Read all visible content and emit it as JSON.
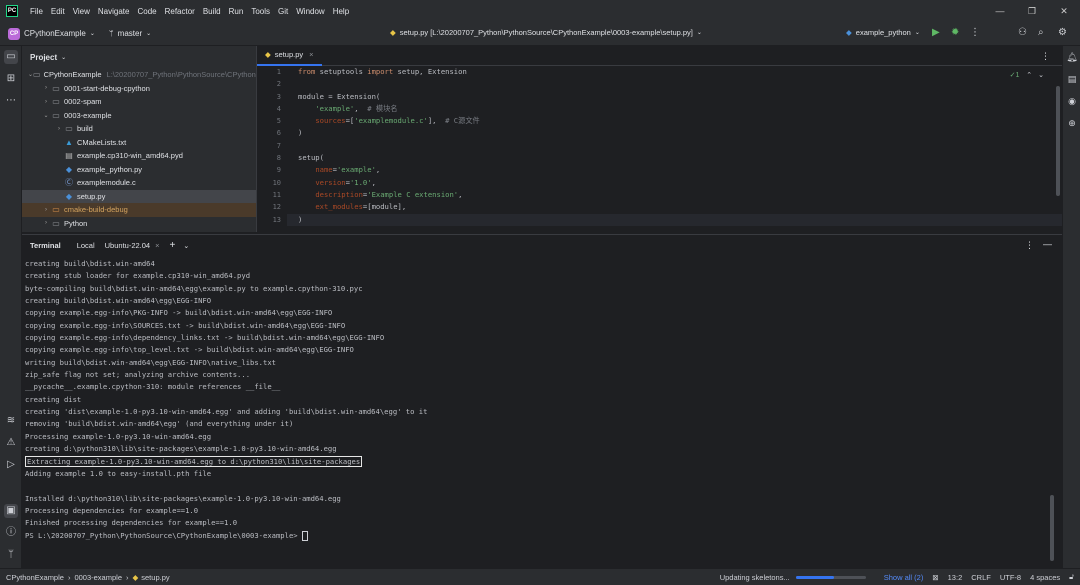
{
  "menu": [
    "File",
    "Edit",
    "View",
    "Navigate",
    "Code",
    "Refactor",
    "Build",
    "Run",
    "Tools",
    "Git",
    "Window",
    "Help"
  ],
  "toolbar": {
    "project_badge": "CP",
    "project_name": "CPythonExample",
    "branch": "master",
    "file_path": "setup.py [L:\\20200707_Python\\PythonSource\\CPythonExample\\0003-example\\setup.py]",
    "run_config": "example_python"
  },
  "project": {
    "title": "Project",
    "items": [
      {
        "label": "CPythonExample",
        "extra": "L:\\20200707_Python\\PythonSource\\CPythonExam",
        "depth": 0,
        "arrow": "v",
        "icon": "folder-icon"
      },
      {
        "label": "0001-start-debug-cpython",
        "depth": 1,
        "arrow": ">",
        "icon": "folder-icon"
      },
      {
        "label": "0002-spam",
        "depth": 1,
        "arrow": ">",
        "icon": "folder-icon"
      },
      {
        "label": "0003-example",
        "depth": 1,
        "arrow": "v",
        "icon": "folder-icon"
      },
      {
        "label": "build",
        "depth": 2,
        "arrow": ">",
        "icon": "folder-icon"
      },
      {
        "label": "CMakeLists.txt",
        "depth": 2,
        "arrow": "",
        "icon": "cmake-icon"
      },
      {
        "label": "example.cp310-win_amd64.pyd",
        "depth": 2,
        "arrow": "",
        "icon": "file-icon"
      },
      {
        "label": "example_python.py",
        "depth": 2,
        "arrow": "",
        "icon": "python-icon"
      },
      {
        "label": "examplemodule.c",
        "depth": 2,
        "arrow": "",
        "icon": "c-file-icon"
      },
      {
        "label": "setup.py",
        "depth": 2,
        "arrow": "",
        "icon": "python-icon"
      },
      {
        "label": "cmake-build-debug",
        "depth": 1,
        "arrow": ">",
        "icon": "folder-icon"
      },
      {
        "label": "Python",
        "depth": 1,
        "arrow": ">",
        "icon": "folder-icon"
      }
    ]
  },
  "editor": {
    "tab": "setup.py",
    "line_numbers": [
      "1",
      "2",
      "3",
      "4",
      "5",
      "6",
      "7",
      "8",
      "9",
      "10",
      "11",
      "12",
      "13"
    ],
    "inspection_count": "1",
    "lines": [
      [
        {
          "t": "from",
          "c": "kw"
        },
        {
          "t": " setuptools ",
          "c": ""
        },
        {
          "t": "import",
          "c": "kw"
        },
        {
          "t": " setup, Extension",
          "c": ""
        }
      ],
      [],
      [
        {
          "t": "module = Extension(",
          "c": ""
        }
      ],
      [
        {
          "t": "    ",
          "c": ""
        },
        {
          "t": "'example'",
          "c": "st"
        },
        {
          "t": ",  ",
          "c": ""
        },
        {
          "t": "# 模块名",
          "c": "cm"
        }
      ],
      [
        {
          "t": "    ",
          "c": ""
        },
        {
          "t": "sources",
          "c": "pa"
        },
        {
          "t": "=[",
          "c": ""
        },
        {
          "t": "'examplemodule.c'",
          "c": "st"
        },
        {
          "t": "],  ",
          "c": ""
        },
        {
          "t": "# C源文件",
          "c": "cm"
        }
      ],
      [
        {
          "t": ")",
          "c": ""
        }
      ],
      [],
      [
        {
          "t": "setup(",
          "c": ""
        }
      ],
      [
        {
          "t": "    ",
          "c": ""
        },
        {
          "t": "name",
          "c": "pa"
        },
        {
          "t": "=",
          "c": ""
        },
        {
          "t": "'example'",
          "c": "st"
        },
        {
          "t": ",",
          "c": ""
        }
      ],
      [
        {
          "t": "    ",
          "c": ""
        },
        {
          "t": "version",
          "c": "pa"
        },
        {
          "t": "=",
          "c": ""
        },
        {
          "t": "'1.0'",
          "c": "st"
        },
        {
          "t": ",",
          "c": ""
        }
      ],
      [
        {
          "t": "    ",
          "c": ""
        },
        {
          "t": "description",
          "c": "pa"
        },
        {
          "t": "=",
          "c": ""
        },
        {
          "t": "'Example C extension'",
          "c": "st"
        },
        {
          "t": ",",
          "c": ""
        }
      ],
      [
        {
          "t": "    ",
          "c": ""
        },
        {
          "t": "ext_modules",
          "c": "pa"
        },
        {
          "t": "=[module],",
          "c": ""
        }
      ],
      [
        {
          "t": ")",
          "c": ""
        }
      ]
    ]
  },
  "terminal": {
    "title": "Terminal",
    "tabs": [
      "Local",
      "Ubuntu-22.04"
    ],
    "highlighted_index": 17,
    "lines": [
      "creating build\\bdist.win-amd64",
      "creating stub loader for example.cp310-win_amd64.pyd",
      "byte-compiling build\\bdist.win-amd64\\egg\\example.py to example.cpython-310.pyc",
      "creating build\\bdist.win-amd64\\egg\\EGG-INFO",
      "copying example.egg-info\\PKG-INFO -> build\\bdist.win-amd64\\egg\\EGG-INFO",
      "copying example.egg-info\\SOURCES.txt -> build\\bdist.win-amd64\\egg\\EGG-INFO",
      "copying example.egg-info\\dependency_links.txt -> build\\bdist.win-amd64\\egg\\EGG-INFO",
      "copying example.egg-info\\top_level.txt -> build\\bdist.win-amd64\\egg\\EGG-INFO",
      "writing build\\bdist.win-amd64\\egg\\EGG-INFO\\native_libs.txt",
      "zip_safe flag not set; analyzing archive contents...",
      "__pycache__.example.cpython-310: module references __file__",
      "creating dist",
      "creating 'dist\\example-1.0-py3.10-win-amd64.egg' and adding 'build\\bdist.win-amd64\\egg' to it",
      "removing 'build\\bdist.win-amd64\\egg' (and everything under it)",
      "Processing example-1.0-py3.10-win-amd64.egg",
      "creating d:\\python310\\lib\\site-packages\\example-1.0-py3.10-win-amd64.egg",
      "Extracting example-1.0-py3.10-win-amd64.egg to d:\\python310\\lib\\site-packages",
      "Adding example 1.0 to easy-install.pth file",
      "",
      "Installed d:\\python310\\lib\\site-packages\\example-1.0-py3.10-win-amd64.egg",
      "Processing dependencies for example==1.0",
      "Finished processing dependencies for example==1.0",
      "PS L:\\20200707_Python\\PythonSource\\CPythonExample\\0003-example> "
    ]
  },
  "status": {
    "breadcrumb": [
      "CPythonExample",
      "0003-example",
      "setup.py"
    ],
    "task": "Updating skeletons...",
    "progress": 0.55,
    "show_all": "Show all (2)",
    "position": "13:2",
    "line_sep": "CRLF",
    "encoding": "UTF-8",
    "indent": "4 spaces"
  }
}
